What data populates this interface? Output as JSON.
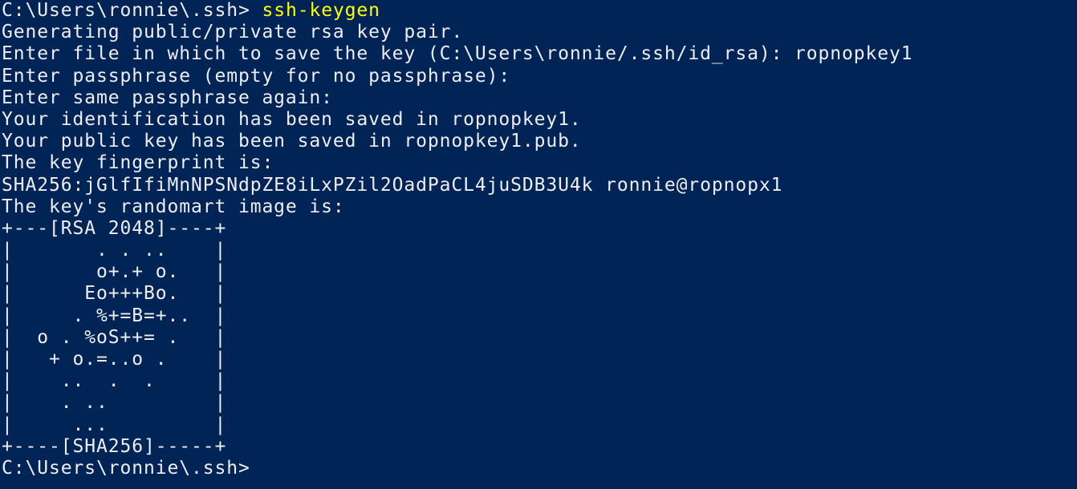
{
  "theme": {
    "background": "#012456",
    "foreground": "#eeedf0",
    "command_color": "#ffff00"
  },
  "terminal": {
    "prompt": "C:\\Users\\ronnie\\.ssh> ",
    "command": "ssh-keygen",
    "lines": [
      "Generating public/private rsa key pair.",
      "Enter file in which to save the key (C:\\Users\\ronnie/.ssh/id_rsa): ropnopkey1",
      "Enter passphrase (empty for no passphrase):",
      "Enter same passphrase again:",
      "Your identification has been saved in ropnopkey1.",
      "Your public key has been saved in ropnopkey1.pub.",
      "The key fingerprint is:",
      "SHA256:jGlfIfiMnNPSNdpZE8iLxPZil2OadPaCL4juSDB3U4k ronnie@ropnopx1",
      "The key's randomart image is:",
      "+---[RSA 2048]----+",
      "|       . . ..    |",
      "|       o+.+ o.   |",
      "|      Eo+++Bo.   |",
      "|     . %+=B=+..  |",
      "|  o . %oS++= .   |",
      "|   + o.=..o .    |",
      "|    ..  .  .     |",
      "|    . ..         |",
      "|     ...         |",
      "+----[SHA256]-----+"
    ],
    "final_prompt": "C:\\Users\\ronnie\\.ssh>"
  }
}
